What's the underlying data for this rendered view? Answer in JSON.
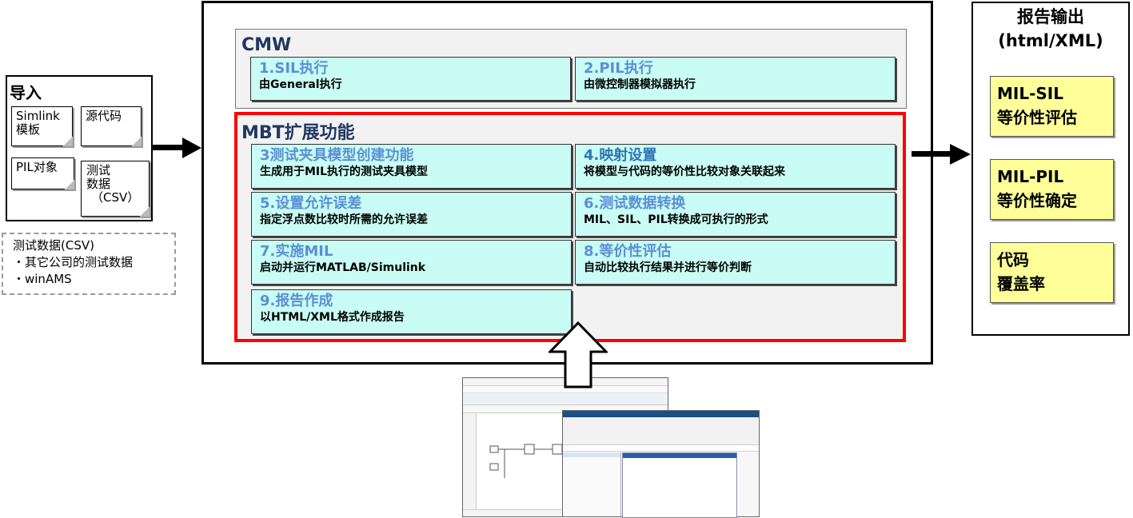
{
  "import": {
    "title": "导入",
    "notes": {
      "simulink": [
        "Simlink",
        "模板"
      ],
      "source": "源代码",
      "pil": "PIL对象",
      "testdata": [
        "测试",
        "数据",
        "（CSV）"
      ]
    },
    "csv_box": [
      "测试数据(CSV)",
      "・其它公司的测试数据",
      "・winAMS"
    ]
  },
  "cmw": {
    "title": "CMW",
    "cells": [
      {
        "title": "1.SIL执行",
        "desc": "由General执行"
      },
      {
        "title": "2.PIL执行",
        "desc": "由微控制器模拟器执行"
      }
    ]
  },
  "mbt": {
    "title": "MBT扩展功能",
    "cells": [
      {
        "title": "3测试夹具模型创建功能",
        "desc": "生成用于MIL执行的测试夹具模型"
      },
      {
        "title": "4.映射设置",
        "desc": "将模型与代码的等价性比较对象关联起来"
      },
      {
        "title": "5.设置允许误差",
        "desc": "指定浮点数比较时所需的允许误差"
      },
      {
        "title": "6.测试数据转换",
        "desc": "MIL、SIL、PIL转换成可执行的形式"
      },
      {
        "title": "7.实施MIL",
        "desc": "启动并运行MATLAB/Simulink"
      },
      {
        "title": "8.等价性评估",
        "desc": "自动比较执行结果并进行等价判断"
      },
      {
        "title": "9.报告作成",
        "desc": "以HTML/XML格式作成报告"
      }
    ]
  },
  "report": {
    "title": [
      "报告输出",
      "(html/XML)"
    ],
    "notes": [
      [
        "MIL-SIL",
        "等价性评估"
      ],
      [
        "MIL-PIL",
        "等价性确定"
      ],
      [
        "代码",
        "覆盖率"
      ]
    ]
  },
  "colors": {
    "cell_bg": "#c8fcf4",
    "cell_title": "#5b8fd4",
    "section_title": "#1f3864",
    "mbt_border": "#ff0000",
    "note_yellow": "#ffff99"
  }
}
